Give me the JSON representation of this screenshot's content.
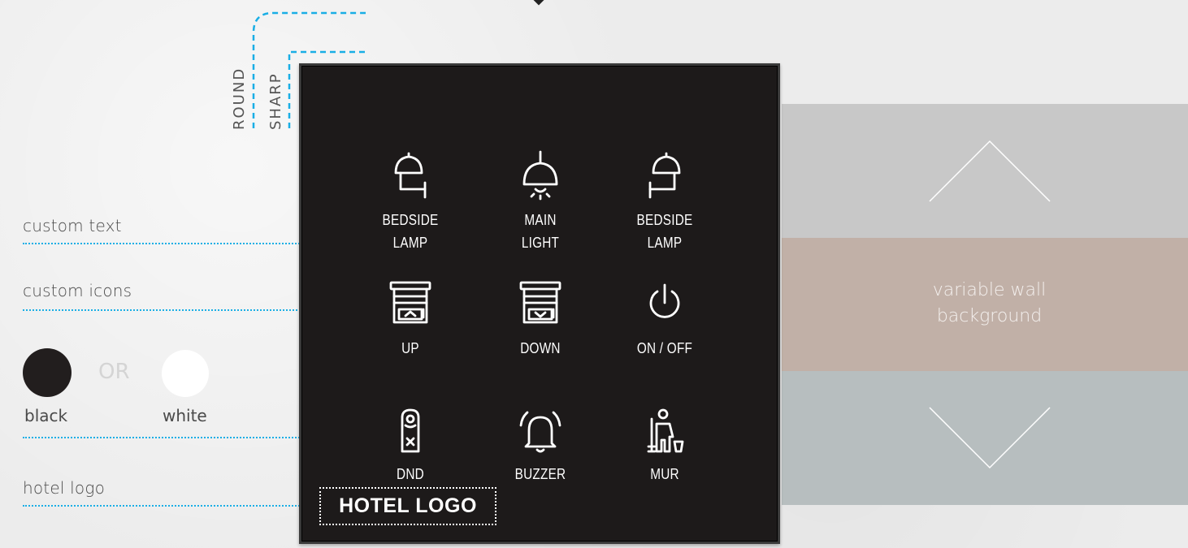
{
  "annotations": {
    "custom_text": "custom text",
    "custom_icons": "custom icons",
    "hotel_logo": "hotel logo"
  },
  "colors_choice": {
    "black_label": "black",
    "or_label": "OR",
    "white_label": "white"
  },
  "corners": {
    "round_label": "ROUND",
    "sharp_label": "SHARP"
  },
  "panel": {
    "buttons": [
      {
        "line1": "BEDSIDE",
        "line2": "LAMP",
        "icon": "bedside-lamp-left-icon"
      },
      {
        "line1": "MAIN",
        "line2": "LIGHT",
        "icon": "ceiling-lamp-icon"
      },
      {
        "line1": "BEDSIDE",
        "line2": "LAMP",
        "icon": "bedside-lamp-right-icon"
      },
      {
        "line1": "UP",
        "line2": "",
        "icon": "blind-up-icon"
      },
      {
        "line1": "DOWN",
        "line2": "",
        "icon": "blind-down-icon"
      },
      {
        "line1": "ON / OFF",
        "line2": "",
        "icon": "power-icon"
      },
      {
        "line1": "DND",
        "line2": "",
        "icon": "door-hanger-icon"
      },
      {
        "line1": "BUZZER",
        "line2": "",
        "icon": "bell-icon"
      },
      {
        "line1": "MUR",
        "line2": "",
        "icon": "housekeeping-icon"
      }
    ],
    "hotel_logo": "HOTEL LOGO"
  },
  "wall": {
    "text_line1": "variable wall",
    "text_line2": "background"
  },
  "palette": {
    "accent": "#19aee5",
    "panel": "#1d1a1a",
    "wall_grey": "#c8c8c8",
    "wall_beige": "#c1b0a7",
    "wall_blue": "#b7bebf"
  }
}
